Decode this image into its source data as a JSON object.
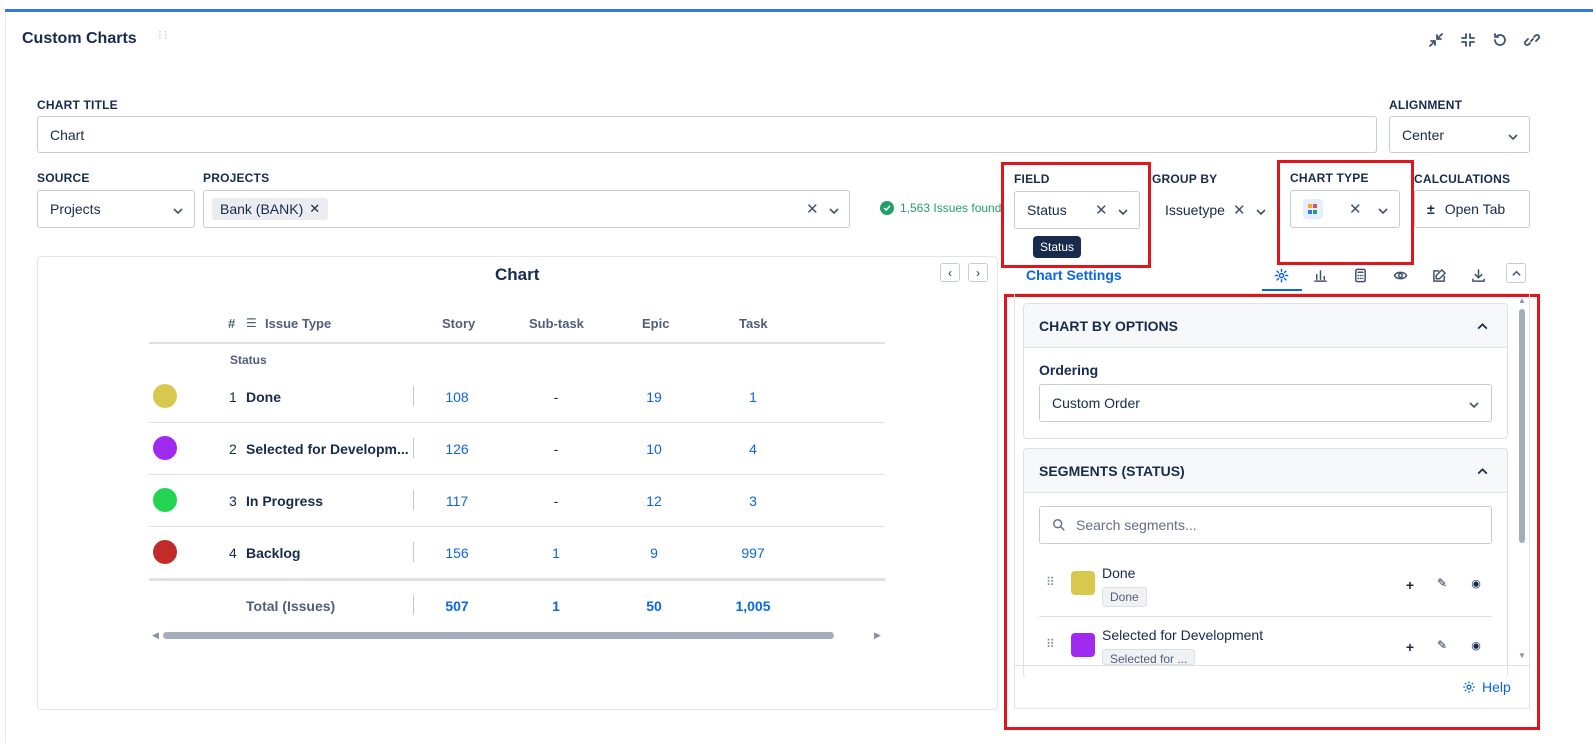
{
  "app": {
    "title": "Custom Charts"
  },
  "form": {
    "chart_title_label": "CHART TITLE",
    "chart_title_value": "Chart",
    "alignment_label": "ALIGNMENT",
    "alignment_value": "Center",
    "source_label": "SOURCE",
    "source_value": "Projects",
    "projects_label": "PROJECTS",
    "project_chip": "Bank (BANK)",
    "issues_found": "1,563 Issues found",
    "field_label": "FIELD",
    "field_value": "Status",
    "field_tooltip": "Status",
    "group_by_label": "GROUP BY",
    "group_by_value": "Issuetype",
    "chart_type_label": "CHART TYPE",
    "calculations_label": "CALCULATIONS",
    "calculations_button": "Open Tab"
  },
  "chart": {
    "title": "Chart",
    "columns": {
      "hash": "#",
      "issue_type": "Issue Type",
      "story": "Story",
      "subtask": "Sub-task",
      "epic": "Epic",
      "task": "Task"
    },
    "row_group_label": "Status",
    "rows": [
      {
        "index": "1",
        "name": "Done",
        "color": "#d9c84e",
        "story": "108",
        "subtask": "-",
        "epic": "19",
        "task": "1"
      },
      {
        "index": "2",
        "name": "Selected for Developm...",
        "color": "#a12af0",
        "story": "126",
        "subtask": "-",
        "epic": "10",
        "task": "4"
      },
      {
        "index": "3",
        "name": "In Progress",
        "color": "#22d44f",
        "story": "117",
        "subtask": "-",
        "epic": "12",
        "task": "3"
      },
      {
        "index": "4",
        "name": "Backlog",
        "color": "#c32b2b",
        "story": "156",
        "subtask": "1",
        "epic": "9",
        "task": "997"
      }
    ],
    "total": {
      "label": "Total (Issues)",
      "story": "507",
      "subtask": "1",
      "epic": "50",
      "task": "1,005"
    }
  },
  "settings": {
    "tab_label": "Chart Settings",
    "chart_by_header": "CHART BY OPTIONS",
    "ordering_label": "Ordering",
    "ordering_value": "Custom Order",
    "segments_header": "SEGMENTS (STATUS)",
    "search_placeholder": "Search segments...",
    "segments": [
      {
        "name": "Done",
        "tag": "Done",
        "color": "#d9c84e"
      },
      {
        "name": "Selected for Development",
        "tag": "Selected for ...",
        "color": "#a12af0"
      }
    ],
    "help": "Help"
  },
  "colors": {
    "accent": "#0c66e4",
    "highlight": "#e0161d",
    "topbar": "#2f7de1",
    "success": "#22a06b"
  }
}
